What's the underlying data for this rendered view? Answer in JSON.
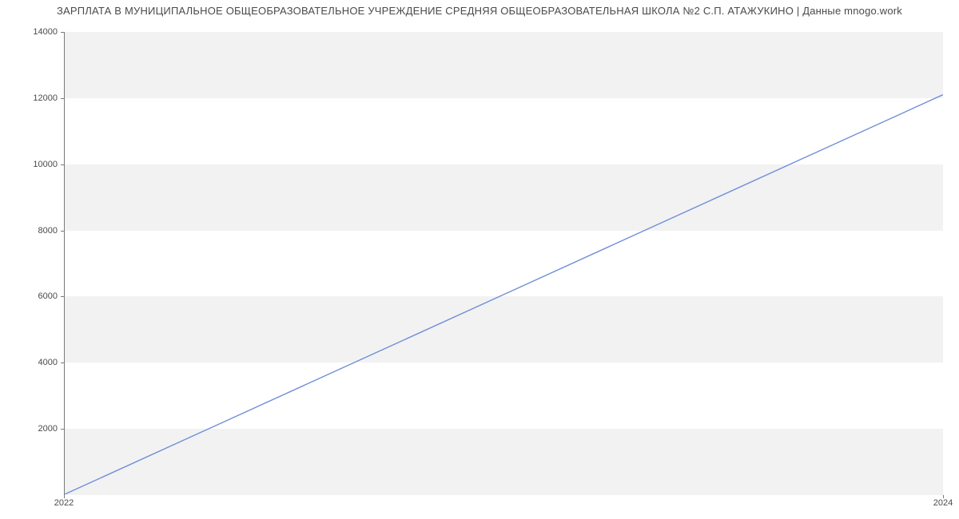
{
  "chart_data": {
    "type": "line",
    "title": "ЗАРПЛАТА В МУНИЦИПАЛЬНОЕ  ОБЩЕОБРАЗОВАТЕЛЬНОЕ УЧРЕЖДЕНИЕ СРЕДНЯЯ ОБЩЕОБРАЗОВАТЕЛЬНАЯ ШКОЛА №2 С.П. АТАЖУКИНО | Данные mnogo.work",
    "x": [
      2022,
      2024
    ],
    "values": [
      0,
      12100
    ],
    "xlabel": "",
    "ylabel": "",
    "xlim": [
      2022,
      2024
    ],
    "ylim": [
      0,
      14000
    ],
    "yticks": [
      2000,
      4000,
      6000,
      8000,
      10000,
      12000,
      14000
    ],
    "xticks": [
      2022,
      2024
    ],
    "line_color": "#6f8fd9",
    "band_color": "#f2f2f2"
  }
}
